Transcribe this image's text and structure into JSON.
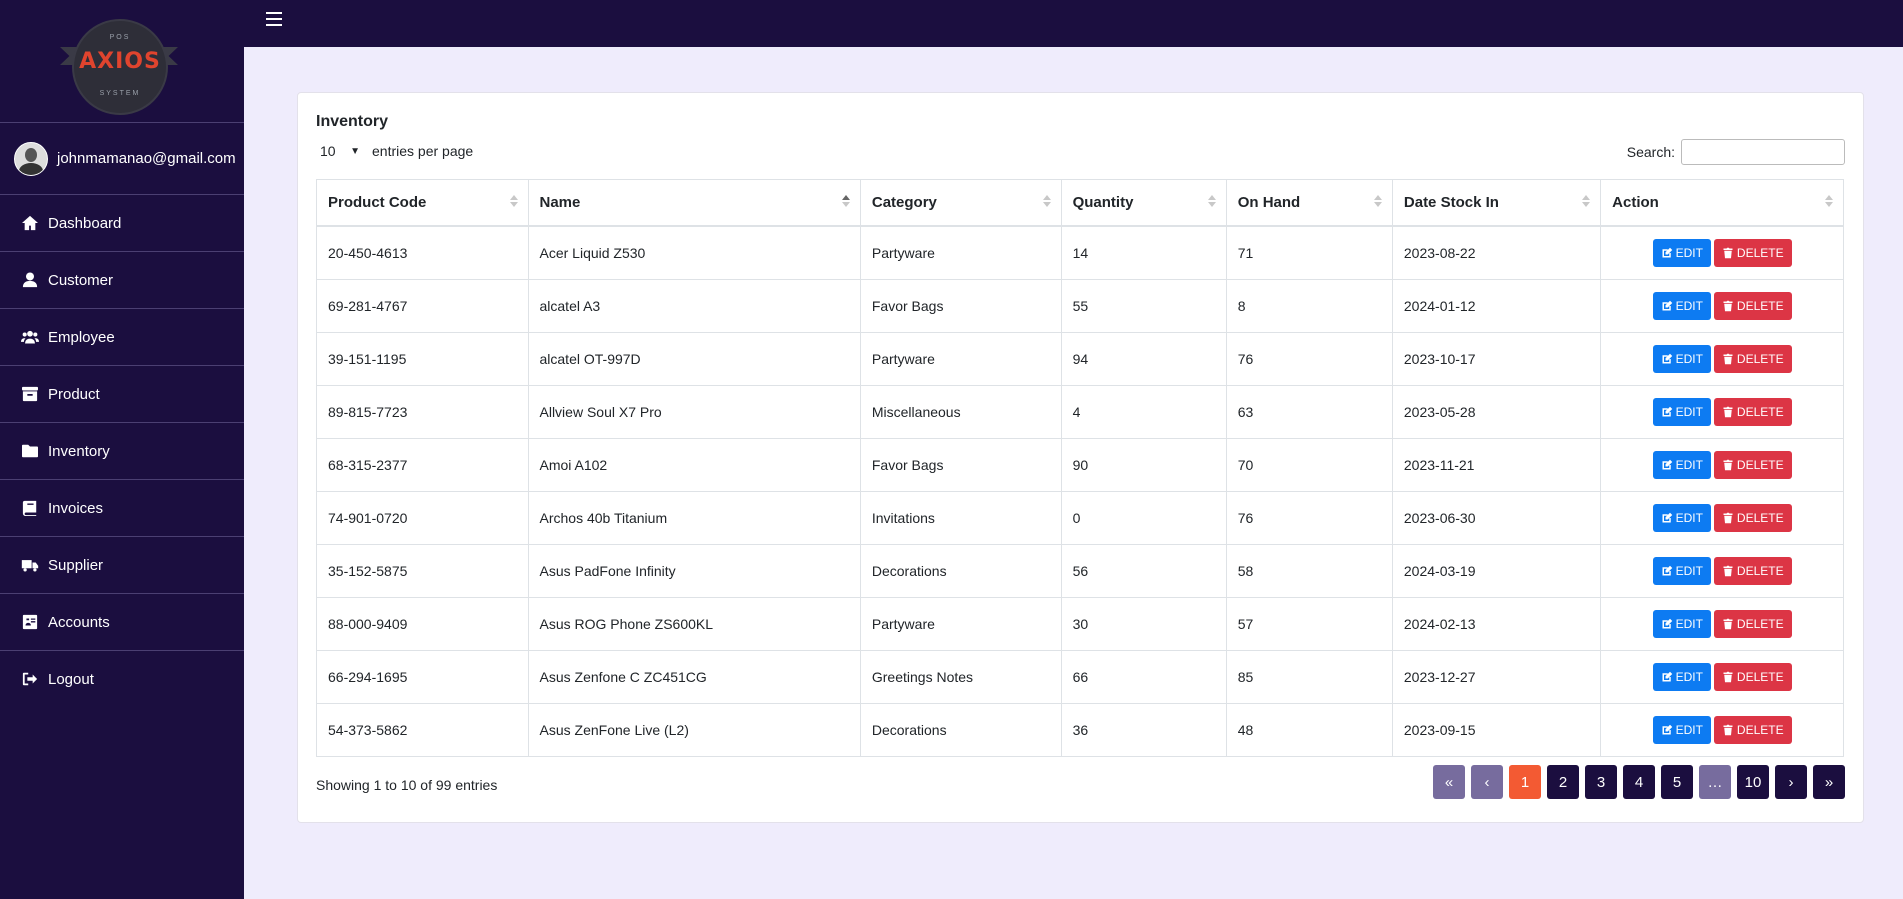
{
  "logo": {
    "top": "POS",
    "main": "AXIOS",
    "bottom": "SYSTEM"
  },
  "user": {
    "email": "johnmamanao@gmail.com"
  },
  "nav": [
    {
      "label": "Dashboard",
      "icon": "home-icon"
    },
    {
      "label": "Customer",
      "icon": "user-icon"
    },
    {
      "label": "Employee",
      "icon": "users-icon"
    },
    {
      "label": "Product",
      "icon": "archive-icon"
    },
    {
      "label": "Inventory",
      "icon": "folder-icon"
    },
    {
      "label": "Invoices",
      "icon": "book-icon"
    },
    {
      "label": "Supplier",
      "icon": "truck-icon"
    },
    {
      "label": "Accounts",
      "icon": "id-card-icon"
    },
    {
      "label": "Logout",
      "icon": "sign-out-icon"
    }
  ],
  "card": {
    "title": "Inventory",
    "entries_value": "10",
    "entries_label": "entries per page",
    "search_label": "Search:",
    "search_value": ""
  },
  "table": {
    "columns": [
      "Product Code",
      "Name",
      "Category",
      "Quantity",
      "On Hand",
      "Date Stock In",
      "Action"
    ],
    "sorted_column": "Name",
    "rows": [
      [
        "20-450-4613",
        "Acer Liquid Z530",
        "Partyware",
        "14",
        "71",
        "2023-08-22"
      ],
      [
        "69-281-4767",
        "alcatel A3",
        "Favor Bags",
        "55",
        "8",
        "2024-01-12"
      ],
      [
        "39-151-1195",
        "alcatel OT-997D",
        "Partyware",
        "94",
        "76",
        "2023-10-17"
      ],
      [
        "89-815-7723",
        "Allview Soul X7 Pro",
        "Miscellaneous",
        "4",
        "63",
        "2023-05-28"
      ],
      [
        "68-315-2377",
        "Amoi A102",
        "Favor Bags",
        "90",
        "70",
        "2023-11-21"
      ],
      [
        "74-901-0720",
        "Archos 40b Titanium",
        "Invitations",
        "0",
        "76",
        "2023-06-30"
      ],
      [
        "35-152-5875",
        "Asus PadFone Infinity",
        "Decorations",
        "56",
        "58",
        "2024-03-19"
      ],
      [
        "88-000-9409",
        "Asus ROG Phone ZS600KL",
        "Partyware",
        "30",
        "57",
        "2024-02-13"
      ],
      [
        "66-294-1695",
        "Asus Zenfone C ZC451CG",
        "Greetings Notes",
        "66",
        "85",
        "2023-12-27"
      ],
      [
        "54-373-5862",
        "Asus ZenFone Live (L2)",
        "Decorations",
        "36",
        "48",
        "2023-09-15"
      ]
    ],
    "edit_label": "EDIT",
    "delete_label": "DELETE"
  },
  "footer": {
    "info": "Showing 1 to 10 of 99 entries",
    "pages": [
      "«",
      "‹",
      "1",
      "2",
      "3",
      "4",
      "5",
      "…",
      "10",
      "›",
      "»"
    ],
    "active_page": "1"
  },
  "colors": {
    "sidebar": "#1b0e3f",
    "background": "#efecfc",
    "edit": "#0d7bf2",
    "delete": "#dc3545",
    "active_page": "#f35a33",
    "muted_page": "#776c9e"
  }
}
